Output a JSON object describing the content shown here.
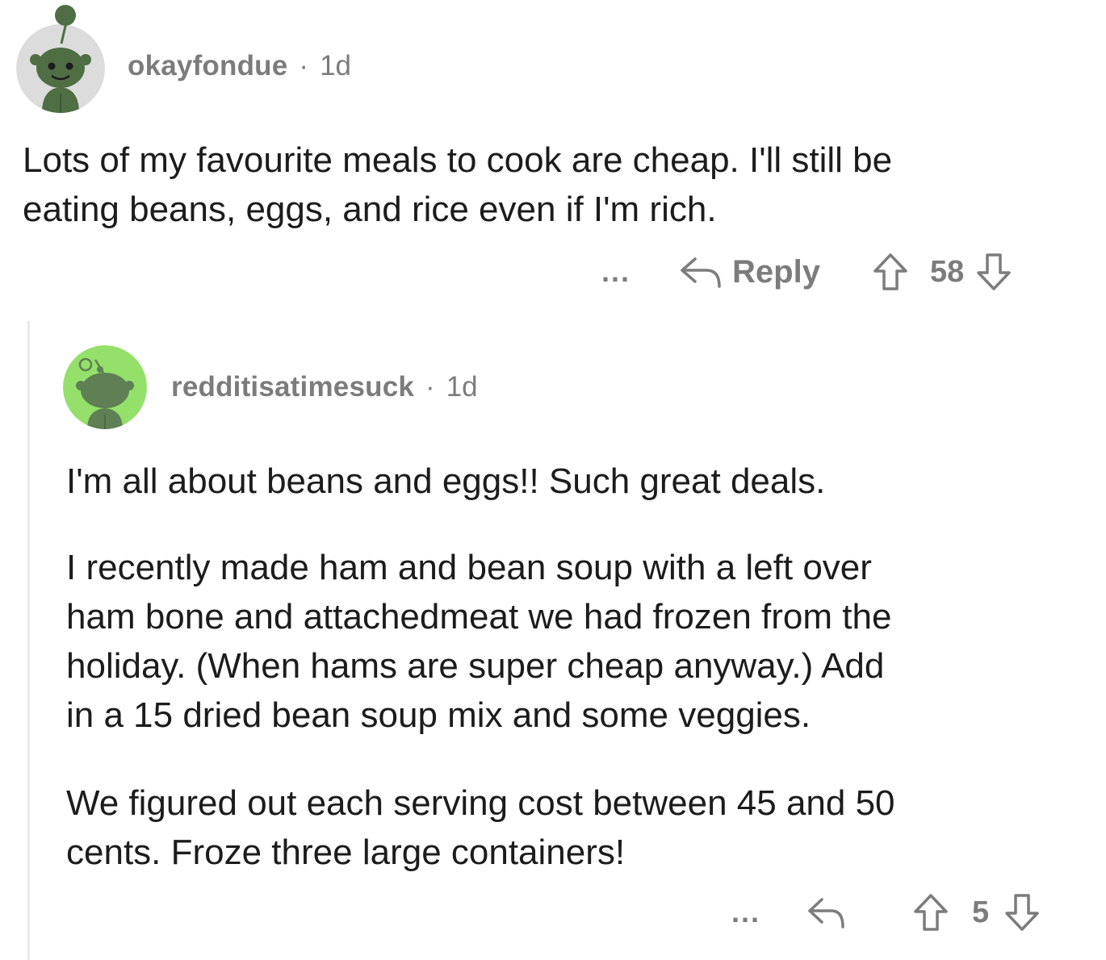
{
  "comments": [
    {
      "username": "okayfondue",
      "separator": "·",
      "age": "1d",
      "body": "Lots of my favourite meals to cook are cheap. I'll still be\neating beans, eggs, and rice even if I'm rich.",
      "more": "...",
      "reply_label": "Reply",
      "votes": "58",
      "avatar_bg": "#dcdcdc",
      "avatar_color": "#4f6e44"
    },
    {
      "username": "redditisatimesuck",
      "separator": "·",
      "age": "1d",
      "paragraphs": [
        "I'm all about beans and eggs!!  Such great deals.",
        "I recently made ham and bean soup with a left over\nham bone and attachedmeat we had frozen from the\nholiday.  (When hams are super cheap anyway.)  Add\nin a 15 dried bean soup mix and some veggies.",
        "We figured out each serving cost between 45 and 50\ncents.  Froze three large containers!"
      ],
      "more": "...",
      "votes": "5",
      "avatar_bg": "#94e06a",
      "avatar_color": "#5f7f55"
    }
  ],
  "icons": {
    "reply": "reply-arrow-icon",
    "upvote": "upvote-arrow-icon",
    "downvote": "downvote-arrow-icon"
  }
}
